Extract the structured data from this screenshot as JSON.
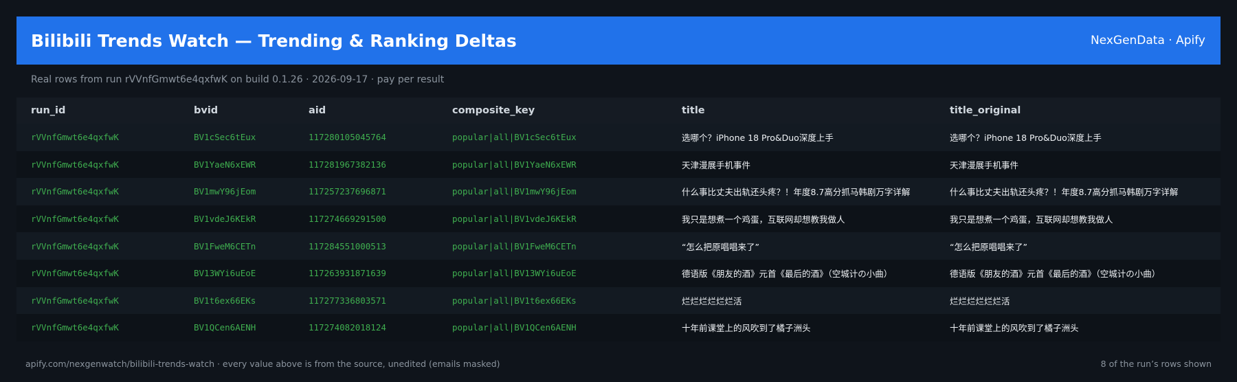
{
  "header": {
    "title": "Bilibili Trends Watch — Trending & Ranking Deltas",
    "brand": "NexGenData · Apify"
  },
  "subtitle": "Real rows from run rVVnfGmwt6e4qxfwK on build 0.1.26 · 2026-09-17 · pay per result",
  "table": {
    "columns": [
      "run_id",
      "bvid",
      "aid",
      "composite_key",
      "title",
      "title_original"
    ],
    "rows": [
      {
        "run_id": "rVVnfGmwt6e4qxfwK",
        "bvid": "BV1cSec6tEux",
        "aid": "117280105045764",
        "composite_key": "popular|all|BV1cSec6tEux",
        "title": "选哪个？iPhone 18 Pro&Duo深度上手",
        "title_original": "选哪个？iPhone 18 Pro&Duo深度上手"
      },
      {
        "run_id": "rVVnfGmwt6e4qxfwK",
        "bvid": "BV1YaeN6xEWR",
        "aid": "117281967382136",
        "composite_key": "popular|all|BV1YaeN6xEWR",
        "title": "天津漫展手机事件",
        "title_original": "天津漫展手机事件"
      },
      {
        "run_id": "rVVnfGmwt6e4qxfwK",
        "bvid": "BV1mwY96jEom",
        "aid": "117257237696871",
        "composite_key": "popular|all|BV1mwY96jEom",
        "title": "什么事比丈夫出轨还头疼？！年度8.7高分抓马韩剧万字详解",
        "title_original": "什么事比丈夫出轨还头疼？！年度8.7高分抓马韩剧万字详解"
      },
      {
        "run_id": "rVVnfGmwt6e4qxfwK",
        "bvid": "BV1vdeJ6KEkR",
        "aid": "117274669291500",
        "composite_key": "popular|all|BV1vdeJ6KEkR",
        "title": "我只是想煮一个鸡蛋，互联网却想教我做人",
        "title_original": "我只是想煮一个鸡蛋，互联网却想教我做人"
      },
      {
        "run_id": "rVVnfGmwt6e4qxfwK",
        "bvid": "BV1FweM6CETn",
        "aid": "117284551000513",
        "composite_key": "popular|all|BV1FweM6CETn",
        "title": "“怎么把原唱唱来了”",
        "title_original": "“怎么把原唱唱来了”"
      },
      {
        "run_id": "rVVnfGmwt6e4qxfwK",
        "bvid": "BV13WYi6uEoE",
        "aid": "117263931871639",
        "composite_key": "popular|all|BV13WYi6uEoE",
        "title": "德语版《朋友的酒》元首《最后的酒》（空城计の小曲）",
        "title_original": "德语版《朋友的酒》元首《最后的酒》（空城计の小曲）"
      },
      {
        "run_id": "rVVnfGmwt6e4qxfwK",
        "bvid": "BV1t6ex66EKs",
        "aid": "117277336803571",
        "composite_key": "popular|all|BV1t6ex66EKs",
        "title": "烂烂烂烂烂烂活",
        "title_original": "烂烂烂烂烂烂活"
      },
      {
        "run_id": "rVVnfGmwt6e4qxfwK",
        "bvid": "BV1QCen6AENH",
        "aid": "117274082018124",
        "composite_key": "popular|all|BV1QCen6AENH",
        "title": "十年前课堂上的风吹到了橘子洲头",
        "title_original": "十年前课堂上的风吹到了橘子洲头"
      }
    ]
  },
  "footer": {
    "left": "apify.com/nexgenwatch/bilibili-trends-watch  ·  every value above is from the source, unedited (emails masked)",
    "right": "8 of the run’s rows shown"
  },
  "colors": {
    "header_bg": "#2172ea",
    "page_bg": "#0f141b",
    "mono_text": "#3fae4f",
    "muted_text": "#8b949e"
  }
}
